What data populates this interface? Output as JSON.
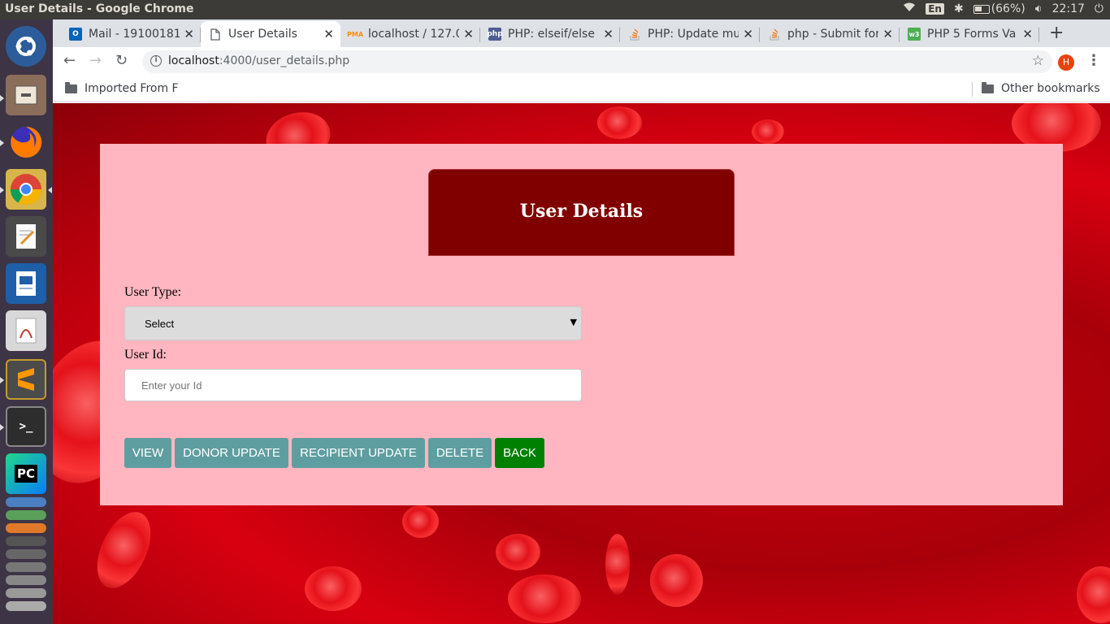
{
  "os": {
    "window_title": "User Details - Google Chrome",
    "tray": {
      "keyboard": "En",
      "battery": "(66%)",
      "time": "22:17"
    }
  },
  "launcher": {
    "items": [
      {
        "name": "ubuntu-dash-icon",
        "color": "#2c5d9a"
      },
      {
        "name": "files-icon",
        "color": "#8b6e5a"
      },
      {
        "name": "firefox-icon",
        "color": "#e66000"
      },
      {
        "name": "chrome-icon",
        "color": "#4285f4"
      },
      {
        "name": "text-editor-icon",
        "color": "#4a4a4a"
      },
      {
        "name": "libreoffice-writer-icon",
        "color": "#1f5fa8"
      },
      {
        "name": "document-viewer-icon",
        "color": "#c0392b"
      },
      {
        "name": "sublime-text-icon",
        "color": "#4b4b4b"
      },
      {
        "name": "terminal-icon",
        "color": "#2d2d2d"
      },
      {
        "name": "pycharm-icon",
        "color": "#21d789"
      }
    ]
  },
  "browser": {
    "tabs": [
      {
        "label": "Mail - 19100181(",
        "favicon": "outlook-icon",
        "favicon_color": "#0364b8",
        "active": false
      },
      {
        "label": "User Details",
        "favicon": "page-icon",
        "favicon_color": "#ffffff",
        "active": true
      },
      {
        "label": "localhost / 127.0",
        "favicon": "phpmyadmin-icon",
        "favicon_color": "#f29111",
        "active": false
      },
      {
        "label": "PHP: elseif/else",
        "favicon": "php-icon",
        "favicon_color": "#4f5b93",
        "active": false
      },
      {
        "label": "PHP: Update mu",
        "favicon": "stackoverflow-icon",
        "favicon_color": "#f48024",
        "active": false
      },
      {
        "label": "php - Submit for",
        "favicon": "stackoverflow-icon",
        "favicon_color": "#f48024",
        "active": false
      },
      {
        "label": "PHP 5 Forms Va",
        "favicon": "w3schools-icon",
        "favicon_color": "#4caf50",
        "active": false
      }
    ],
    "new_tab": "+",
    "address": {
      "host": "localhost",
      "path": ":4000/user_details.php"
    },
    "profile_initial": "H",
    "bookmarks": {
      "left": "Imported From F",
      "right": "Other bookmarks"
    }
  },
  "page": {
    "heading": "User Details",
    "user_type_label": "User Type:",
    "user_type_selected": "Select",
    "user_id_label": "User Id:",
    "user_id_placeholder": "Enter your Id",
    "buttons": {
      "view": "VIEW",
      "donor_update": "DONOR UPDATE",
      "recipient_update": "RECIPIENT UPDATE",
      "delete": "DELETE",
      "back": "BACK"
    },
    "colors": {
      "panel": "#ffb6c1",
      "heading_bg": "#800000",
      "button_teal": "#5f9ea0",
      "button_back": "#008000"
    }
  }
}
